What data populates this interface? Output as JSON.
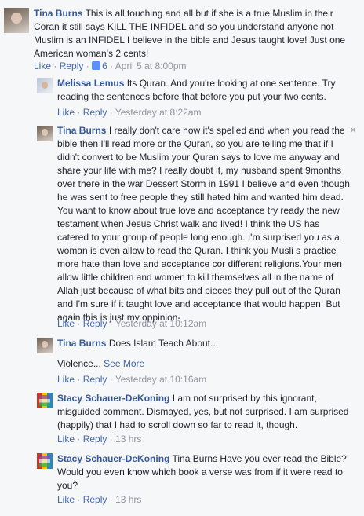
{
  "comments": [
    {
      "author": "Tina Burns",
      "text": "This is all touching and all but if she is a true Muslim in their Coran it still says KILL THE INFIDEL and so you understand anyone not Muslim is an INFIDEL I believe in the bible and Jesus taught love! Just one American woman's 2 cents!",
      "like": "Like",
      "reply": "Reply",
      "like_count": "6",
      "time": "April 5 at 8:00pm"
    },
    {
      "author": "Melissa Lemus",
      "text": "Its Quran. And you're looking at one sentence. Try reading the sentences before that before you put your two cents.",
      "like": "Like",
      "reply": "Reply",
      "time": "Yesterday at 8:22am"
    },
    {
      "author": "Tina Burns",
      "text": "I really don't care how it's spelled and when you read the bible then I'll read more or the Quran, so you are telling me that if I didn't convert to be Muslim your Quran says to love me anyway and share your life with me? I really doubt it, my husband spent 9months over there in the war Dessert Storm in 1991 I believe and even though he was sent to free people they still hated him and wanted him dead. You want to know about true love and acceptance try ready the new testament when Jesus Christ walk and lived! I think the US has catered to your group of people long enough. I'm surprised you as a woman is even allow to read the Quran. I think you Musli s practice more hate than love and acceptance cor different religions.Your men allow little children and women to kill themselves all in the name of Allah just because of what bits and pieces they pull out of the Quran and I'm sure if it taught love and acceptance that would happen! But again this is just my oppinion-",
      "like": "Like",
      "reply": "Reply",
      "time": "Yesterday at 10:12am",
      "close": "×"
    },
    {
      "author": "Tina Burns",
      "text": "Does Islam Teach About...",
      "text2": "Violence...",
      "see_more": "See More",
      "like": "Like",
      "reply": "Reply",
      "time": "Yesterday at 10:16am"
    },
    {
      "author": "Stacy Schauer-DeKoning",
      "text": "I am not surprised by this ignorant, misguided comment. Dismayed, yes, but not surprised. I am surprised (happily) that I had to scroll down so far to read it, though.",
      "like": "Like",
      "reply": "Reply",
      "time": "13 hrs"
    },
    {
      "author": "Stacy Schauer-DeKoning",
      "text": "Tina Burns Have you ever read the Bible? Would you even know which book a verse was from if it were read to you?",
      "like": "Like",
      "reply": "Reply",
      "time": "13 hrs"
    }
  ],
  "separator": "·"
}
